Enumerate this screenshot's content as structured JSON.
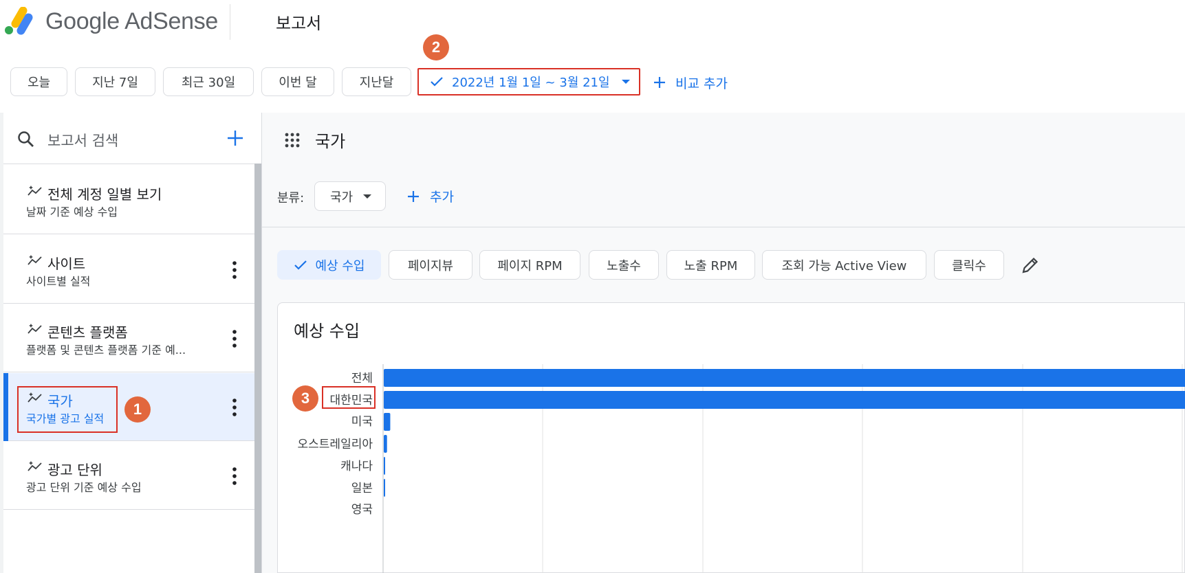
{
  "header": {
    "logo_text": "Google AdSense",
    "page_title": "보고서"
  },
  "date_filter": {
    "chips": [
      "오늘",
      "지난 7일",
      "최근 30일",
      "이번 달",
      "지난달"
    ],
    "selected_range": "2022년 1월 1일 ~ 3월 21일",
    "add_compare": "비교 추가"
  },
  "sidebar": {
    "search_placeholder": "보고서 검색",
    "items": [
      {
        "title": "전체 계정 일별 보기",
        "subtitle": "날짜 기준 예상 수입"
      },
      {
        "title": "사이트",
        "subtitle": "사이트별 실적"
      },
      {
        "title": "콘텐츠 플랫폼",
        "subtitle": "플랫폼 및 콘텐츠 플랫폼 기준 예..."
      },
      {
        "title": "국가",
        "subtitle": "국가별 광고 실적"
      },
      {
        "title": "광고 단위",
        "subtitle": "광고 단위 기준 예상 수입"
      }
    ]
  },
  "main": {
    "report_title": "국가",
    "group_label": "분류:",
    "group_value": "국가",
    "add_label": "추가",
    "metrics": [
      "예상 수입",
      "페이지뷰",
      "페이지 RPM",
      "노출수",
      "노출 RPM",
      "조회 가능 Active View",
      "클릭수"
    ],
    "chart_title": "예상 수입"
  },
  "annotations": {
    "badge1": "1",
    "badge2": "2",
    "badge3": "3"
  },
  "colors": {
    "accent": "#1a73e8",
    "badge": "#e2673d",
    "highlight_box": "#d93025"
  },
  "chart_data": {
    "type": "bar",
    "orientation": "horizontal",
    "title": "예상 수입",
    "categories": [
      "전체",
      "대한민국",
      "미국",
      "오스트레일리아",
      "캐나다",
      "일본",
      "영국"
    ],
    "values": [
      100,
      99,
      0.8,
      0.4,
      0.15,
      0.1,
      0
    ],
    "grid": true
  }
}
